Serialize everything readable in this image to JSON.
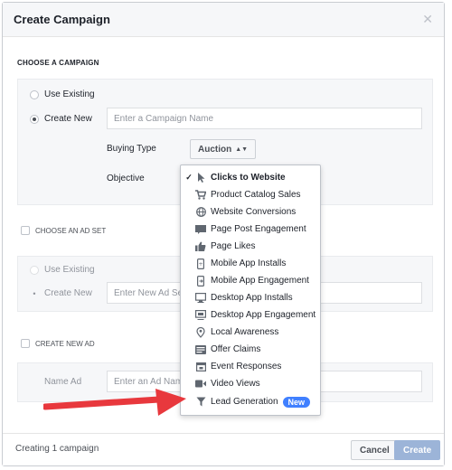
{
  "dialog": {
    "title": "Create Campaign",
    "close_icon": "close-icon"
  },
  "campaign_section": {
    "label": "CHOOSE A CAMPAIGN",
    "use_existing_label": "Use Existing",
    "create_new_label": "Create New",
    "selected": "create_new",
    "campaign_name_placeholder": "Enter a Campaign Name",
    "buying_type_label": "Buying Type",
    "buying_type_value": "Auction",
    "objective_label": "Objective"
  },
  "objective_dropdown": {
    "items": [
      {
        "label": "Clicks to Website",
        "icon": "cursor-icon",
        "selected": true
      },
      {
        "label": "Product Catalog Sales",
        "icon": "cart-icon"
      },
      {
        "label": "Website Conversions",
        "icon": "globe-icon"
      },
      {
        "label": "Page Post Engagement",
        "icon": "post-icon"
      },
      {
        "label": "Page Likes",
        "icon": "thumbs-up-icon"
      },
      {
        "label": "Mobile App Installs",
        "icon": "mobile-icon"
      },
      {
        "label": "Mobile App Engagement",
        "icon": "mobile-engage-icon"
      },
      {
        "label": "Desktop App Installs",
        "icon": "desktop-icon"
      },
      {
        "label": "Desktop App Engagement",
        "icon": "desktop-engage-icon"
      },
      {
        "label": "Local Awareness",
        "icon": "pin-icon"
      },
      {
        "label": "Offer Claims",
        "icon": "offer-icon"
      },
      {
        "label": "Event Responses",
        "icon": "calendar-icon"
      },
      {
        "label": "Video Views",
        "icon": "video-icon"
      },
      {
        "label": "Lead Generation",
        "icon": "funnel-icon",
        "badge": "New"
      }
    ]
  },
  "ad_set_section": {
    "label": "CHOOSE AN AD SET",
    "use_existing_label": "Use Existing",
    "create_new_label": "Create New",
    "ad_set_name_placeholder": "Enter New Ad Set Name"
  },
  "ad_section": {
    "label": "CREATE NEW AD",
    "name_label": "Name Ad",
    "ad_name_placeholder": "Enter an Ad Name"
  },
  "footer": {
    "status": "Creating 1 campaign",
    "cancel_label": "Cancel",
    "create_label": "Create"
  },
  "colors": {
    "accent": "#4080ff",
    "arrow": "#e8383d",
    "create_disabled": "#9cb4d8"
  }
}
